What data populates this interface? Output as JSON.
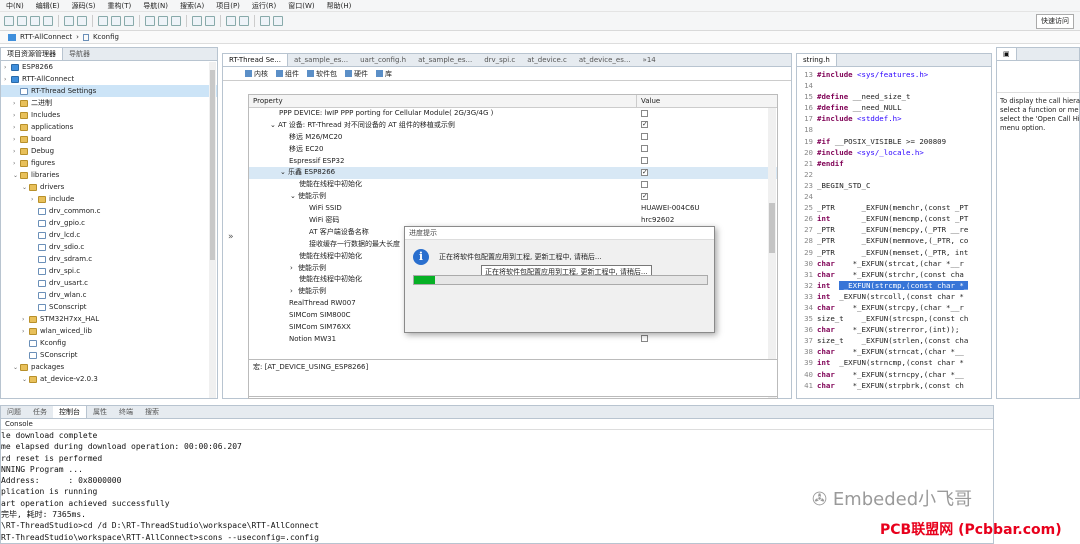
{
  "menu": [
    "中(N)",
    "编辑(E)",
    "源码(S)",
    "重构(T)",
    "导航(N)",
    "搜索(A)",
    "项目(P)",
    "运行(R)",
    "窗口(W)",
    "帮助(H)"
  ],
  "quick_access": "快速访问",
  "breadcrumb": [
    "RTT-AllConnect",
    "Kconfig"
  ],
  "explorer": {
    "tabs": [
      "项目资源管理器",
      "导航器"
    ],
    "items": [
      {
        "label": "ESP8266",
        "depth": 0,
        "kind": "proj"
      },
      {
        "label": "RTT-AllConnect",
        "depth": 0,
        "kind": "proj"
      },
      {
        "label": "RT-Thread Settings",
        "depth": 1,
        "kind": "file",
        "selected": true
      },
      {
        "label": "二进制",
        "depth": 1,
        "kind": "fold"
      },
      {
        "label": "Includes",
        "depth": 1,
        "kind": "fold"
      },
      {
        "label": "applications",
        "depth": 1,
        "kind": "fold"
      },
      {
        "label": "board",
        "depth": 1,
        "kind": "fold"
      },
      {
        "label": "Debug",
        "depth": 1,
        "kind": "fold"
      },
      {
        "label": "figures",
        "depth": 1,
        "kind": "fold"
      },
      {
        "label": "libraries",
        "depth": 1,
        "kind": "fold",
        "open": true
      },
      {
        "label": "drivers",
        "depth": 2,
        "kind": "fold",
        "open": true
      },
      {
        "label": "include",
        "depth": 3,
        "kind": "fold"
      },
      {
        "label": "drv_common.c",
        "depth": 3,
        "kind": "file"
      },
      {
        "label": "drv_gpio.c",
        "depth": 3,
        "kind": "file"
      },
      {
        "label": "drv_lcd.c",
        "depth": 3,
        "kind": "file"
      },
      {
        "label": "drv_sdio.c",
        "depth": 3,
        "kind": "file"
      },
      {
        "label": "drv_sdram.c",
        "depth": 3,
        "kind": "file"
      },
      {
        "label": "drv_spi.c",
        "depth": 3,
        "kind": "file"
      },
      {
        "label": "drv_usart.c",
        "depth": 3,
        "kind": "file"
      },
      {
        "label": "drv_wlan.c",
        "depth": 3,
        "kind": "file"
      },
      {
        "label": "SConscript",
        "depth": 3,
        "kind": "file"
      },
      {
        "label": "STM32H7xx_HAL",
        "depth": 2,
        "kind": "fold"
      },
      {
        "label": "wlan_wiced_lib",
        "depth": 2,
        "kind": "fold"
      },
      {
        "label": "Kconfig",
        "depth": 2,
        "kind": "file"
      },
      {
        "label": "SConscript",
        "depth": 2,
        "kind": "file"
      },
      {
        "label": "packages",
        "depth": 1,
        "kind": "fold",
        "open": true
      },
      {
        "label": "at_device-v2.0.3",
        "depth": 2,
        "kind": "fold",
        "open": true
      }
    ]
  },
  "editor": {
    "tabs": [
      "RT-Thread Se...",
      "at_sample_es...",
      "uart_config.h",
      "at_sample_es...",
      "drv_spi.c",
      "at_device.c",
      "at_device_es..."
    ],
    "tab_overflow": "»14",
    "subtabs": [
      "内核",
      "组件",
      "软件包",
      "硬件",
      "库"
    ],
    "col_property": "Property",
    "col_value": "Value",
    "rows": [
      {
        "label": "PPP DEVICE: lwIP PPP porting for Cellular Module( 2G/3G/4G )",
        "indent": 0,
        "check": false
      },
      {
        "label": "AT 设备: RT-Thread 对不同设备的 AT 组件的移植或示例",
        "indent": 0,
        "check": true,
        "arrow": "⌄"
      },
      {
        "label": "移远 M26/MC20",
        "indent": 1,
        "check": false
      },
      {
        "label": "移远 EC20",
        "indent": 1,
        "check": false
      },
      {
        "label": "Espressif ESP32",
        "indent": 1,
        "check": false
      },
      {
        "label": "乐鑫 ESP8266",
        "indent": 1,
        "check": true,
        "arrow": "⌄",
        "highlight": true
      },
      {
        "label": "使能在线程中初始化",
        "indent": 2,
        "check": false
      },
      {
        "label": "使能示例",
        "indent": 2,
        "check": true,
        "arrow": "⌄"
      },
      {
        "label": "WiFi SSID",
        "indent": 3,
        "value": "HUAWEI-004C6U"
      },
      {
        "label": "WiFi 密码",
        "indent": 3,
        "value": "hrc92602"
      },
      {
        "label": "AT 客户端设备名称",
        "indent": 3,
        "value": ""
      },
      {
        "label": "接收缓存一行数据的最大长度",
        "indent": 3,
        "value": ""
      },
      {
        "label": "使能在线程中初始化",
        "indent": 2,
        "value": ""
      },
      {
        "label": "使能示例",
        "indent": 2,
        "arrow": "›",
        "value": ""
      },
      {
        "label": "使能在线程中初始化",
        "indent": 2,
        "value": ""
      },
      {
        "label": "使能示例",
        "indent": 2,
        "arrow": "›",
        "value": ""
      },
      {
        "label": "RealThread RW007",
        "indent": 1,
        "value": ""
      },
      {
        "label": "SIMCom SIM800C",
        "indent": 1,
        "value": ""
      },
      {
        "label": "SIMCom SIM76XX",
        "indent": 1,
        "value": ""
      },
      {
        "label": "Notion MW31",
        "indent": 1,
        "check": false
      }
    ],
    "description": "宏: [AT_DEVICE_USING_ESP8266]"
  },
  "dialog": {
    "title": "进度提示",
    "message": "正在将软件包配置应用到工程, 更新工程中, 请稍后...",
    "tooltip": "正在将软件包配置应用到工程, 更新工程中, 请稍后...",
    "progress": 0.07
  },
  "code": {
    "tab": "string.h",
    "lines": [
      {
        "n": "13",
        "t": [
          [
            "pp",
            "#include "
          ],
          [
            "inc",
            "<sys/features.h>"
          ]
        ]
      },
      {
        "n": "14",
        "t": [
          [
            "",
            ""
          ]
        ]
      },
      {
        "n": "15",
        "t": [
          [
            "pp",
            "#define "
          ],
          [
            "",
            "__need_size_t"
          ]
        ]
      },
      {
        "n": "16",
        "t": [
          [
            "pp",
            "#define "
          ],
          [
            "",
            "__need_NULL"
          ]
        ]
      },
      {
        "n": "17",
        "t": [
          [
            "pp",
            "#include "
          ],
          [
            "inc",
            "<stddef.h>"
          ]
        ]
      },
      {
        "n": "18",
        "t": [
          [
            "",
            ""
          ]
        ]
      },
      {
        "n": "19",
        "t": [
          [
            "pp",
            "#if "
          ],
          [
            "",
            "__POSIX_VISIBLE >= 200809"
          ]
        ]
      },
      {
        "n": "20",
        "t": [
          [
            "pp",
            "#include "
          ],
          [
            "inc",
            "<sys/_locale.h>"
          ]
        ]
      },
      {
        "n": "21",
        "t": [
          [
            "pp",
            "#endif"
          ]
        ]
      },
      {
        "n": "22",
        "t": [
          [
            "",
            ""
          ]
        ]
      },
      {
        "n": "23",
        "t": [
          [
            "",
            "_BEGIN_STD_C"
          ]
        ]
      },
      {
        "n": "24",
        "t": [
          [
            "",
            ""
          ]
        ]
      },
      {
        "n": "25",
        "t": [
          [
            "",
            "_PTR      _EXFUN(memchr,(const _PT"
          ]
        ]
      },
      {
        "n": "26",
        "t": [
          [
            "kw",
            "int"
          ],
          [
            "",
            "       _EXFUN(memcmp,(const _PT"
          ]
        ]
      },
      {
        "n": "27",
        "t": [
          [
            "",
            "_PTR      _EXFUN(memcpy,(_PTR __re"
          ]
        ]
      },
      {
        "n": "28",
        "t": [
          [
            "",
            "_PTR      _EXFUN(memmove,(_PTR, co"
          ]
        ]
      },
      {
        "n": "29",
        "t": [
          [
            "",
            "_PTR      _EXFUN(memset,(_PTR, int"
          ]
        ]
      },
      {
        "n": "30",
        "t": [
          [
            "kw",
            "char"
          ],
          [
            "",
            "    *_EXFUN(strcat,(char *__r"
          ]
        ]
      },
      {
        "n": "31",
        "t": [
          [
            "kw",
            "char"
          ],
          [
            "",
            "    *_EXFUN(strchr,(const cha"
          ]
        ]
      },
      {
        "n": "32",
        "t": [
          [
            "kw",
            "int"
          ],
          [
            "",
            "  "
          ],
          [
            "hl",
            " _EXFUN(strcmp,(const char *_"
          ]
        ]
      },
      {
        "n": "33",
        "t": [
          [
            "kw",
            "int"
          ],
          [
            "",
            "  _EXFUN(strcoll,(const char *"
          ]
        ]
      },
      {
        "n": "34",
        "t": [
          [
            "kw",
            "char"
          ],
          [
            "",
            "    *_EXFUN(strcpy,(char *__r"
          ]
        ]
      },
      {
        "n": "35",
        "t": [
          [
            "",
            "size_t    _EXFUN(strcspn,(const ch"
          ]
        ]
      },
      {
        "n": "36",
        "t": [
          [
            "kw",
            "char"
          ],
          [
            "",
            "    *_EXFUN(strerror,(int));"
          ]
        ]
      },
      {
        "n": "37",
        "t": [
          [
            "",
            "size_t    _EXFUN(strlen,(const cha"
          ]
        ]
      },
      {
        "n": "38",
        "t": [
          [
            "kw",
            "char"
          ],
          [
            "",
            "    *_EXFUN(strncat,(char *__"
          ]
        ]
      },
      {
        "n": "39",
        "t": [
          [
            "kw",
            "int"
          ],
          [
            "",
            "  _EXFUN(strncmp,(const char *"
          ]
        ]
      },
      {
        "n": "40",
        "t": [
          [
            "kw",
            "char"
          ],
          [
            "",
            "    *_EXFUN(strncpy,(char *__"
          ]
        ]
      },
      {
        "n": "41",
        "t": [
          [
            "kw",
            "char"
          ],
          [
            "",
            "    *_EXFUN(strpbrk,(const ch"
          ]
        ]
      }
    ]
  },
  "hierarchy": {
    "lines": [
      "To display the call hiera",
      "select a function or me",
      "select the 'Open Call Hi",
      "menu option."
    ]
  },
  "console": {
    "tabs": [
      "问题",
      "任务",
      "控制台",
      "属性",
      "终端",
      "搜索"
    ],
    "title": "Console",
    "lines": [
      "le download complete",
      "me elapsed during download operation: 00:00:06.207",
      "rd reset is performed",
      "NNING Program ...",
      "Address:      : 0x8000000",
      "plication is running",
      "art operation achieved successfully",
      "完毕, 耗时: 7365ms.",
      "\\RT-ThreadStudio>cd /d D:\\RT-ThreadStudio\\workspace\\RTT-AllConnect",
      "RT-ThreadStudio\\workspace\\RTT-AllConnect>scons --useconfig=.config"
    ]
  },
  "watermark": {
    "wechat": "Embeded小飞哥",
    "site": "PCB联盟网 (Pcbbar.com)"
  }
}
